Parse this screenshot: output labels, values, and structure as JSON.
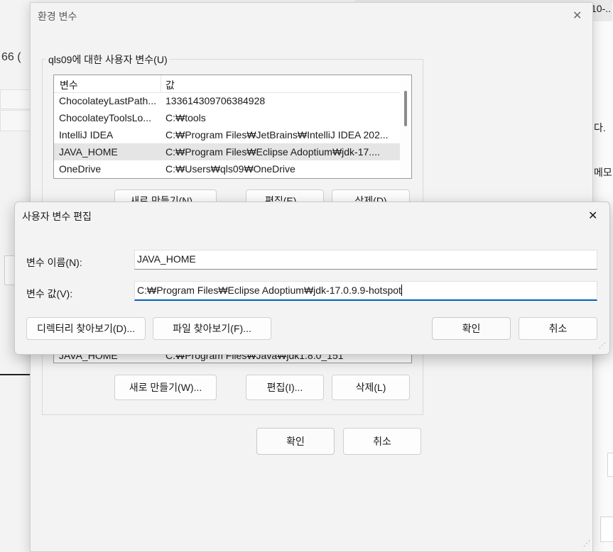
{
  "background": {
    "left_fragment": "66 (",
    "top_right_fragment": "10-..",
    "right_fragment_1": "다.",
    "right_fragment_2": "메모"
  },
  "env_dialog": {
    "title": "환경 변수",
    "user_vars_legend": "qls09에 대한 사용자 변수(U)",
    "columns": [
      "변수",
      "값"
    ],
    "rows": [
      {
        "name": "ChocolateyLastPath...",
        "value": "133614309706384928"
      },
      {
        "name": "ChocolateyToolsLo...",
        "value": "C:₩tools"
      },
      {
        "name": "IntelliJ IDEA",
        "value": "C:₩Program Files₩JetBrains₩IntelliJ IDEA 202..."
      },
      {
        "name": "JAVA_HOME",
        "value": "C:₩Program Files₩Eclipse Adoptium₩jdk-17...."
      },
      {
        "name": "OneDrive",
        "value": "C:₩Users₩qls09₩OneDrive"
      }
    ],
    "user_buttons": {
      "new": "새로 만들기(N)...",
      "edit": "편집(E)...",
      "delete": "삭제(D)"
    },
    "system_row_partial": {
      "name": "JAVA_HOME",
      "value": "C:₩Program Files₩Java₩jdk1.8.0_151"
    },
    "system_buttons": {
      "new": "새로 만들기(W)...",
      "edit": "편집(I)...",
      "delete": "삭제(L)"
    },
    "ok": "확인",
    "cancel": "취소"
  },
  "edit_dialog": {
    "title": "사용자 변수 편집",
    "name_label": "변수 이름(N):",
    "name_value": "JAVA_HOME",
    "value_label": "변수 값(V):",
    "value_value": "C:₩Program Files₩Eclipse Adoptium₩jdk-17.0.9.9-hotspot",
    "browse_dir": "디렉터리 찾아보기(D)...",
    "browse_file": "파일 찾아보기(F)...",
    "ok": "확인",
    "cancel": "취소",
    "close_glyph": "✕"
  },
  "icons": {
    "close": "close-icon",
    "resize": "resize-grip-icon"
  },
  "colors": {
    "accent": "#005fb8",
    "dialog_bg": "#f3f3f3",
    "selected_row": "#e5e5e5"
  }
}
